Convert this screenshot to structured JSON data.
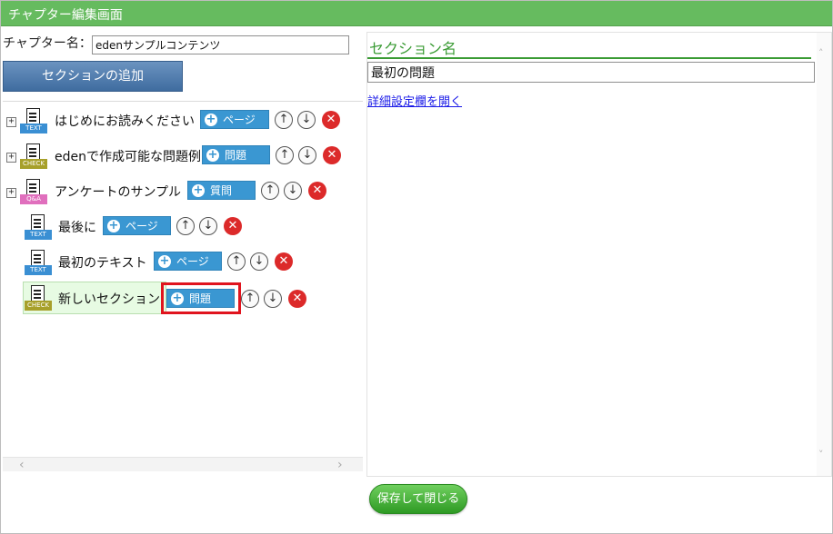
{
  "window": {
    "title": "チャプター編集画面"
  },
  "chapter": {
    "name_label": "チャプター名：",
    "name_value": "edenサンプルコンテンツ"
  },
  "add_section_label": "セクションの追加",
  "tree": [
    {
      "label": "はじめにお読みください",
      "icon": "text-doc-icon",
      "tag": "TEXT",
      "button": "ページ",
      "expandable": true
    },
    {
      "label": "edenで作成可能な問題例",
      "icon": "check-doc-icon",
      "tag": "CHECK",
      "button": "問題",
      "expandable": true
    },
    {
      "label": "アンケートのサンプル",
      "icon": "qa-doc-icon",
      "tag": "Q&A",
      "button": "質問",
      "expandable": true
    },
    {
      "label": "最後に",
      "icon": "text-doc-icon",
      "tag": "TEXT",
      "button": "ページ",
      "expandable": false
    },
    {
      "label": "最初のテキスト",
      "icon": "text-doc-icon",
      "tag": "TEXT",
      "button": "ページ",
      "expandable": false
    },
    {
      "label": "新しいセクション",
      "icon": "check-doc-icon",
      "tag": "CHECK",
      "button": "問題",
      "expandable": false,
      "selected": true,
      "highlighted": true
    }
  ],
  "detail": {
    "title": "セクション名",
    "section_name_value": "最初の問題",
    "open_details_link": "詳細設定欄を開く"
  },
  "save_button": "保存して閉じる",
  "colors": {
    "titlebar": "#66bb5f",
    "accent_green": "#3a9b34",
    "add_button": "#3a97d2",
    "delete": "#dc2a2a",
    "highlight": "#e0141e"
  },
  "glyphs": {
    "expand": "+",
    "plus": "+",
    "up": "↑",
    "down": "↓",
    "delete": "✕",
    "scroll_left": "‹",
    "scroll_right": "›",
    "scroll_up": "˄",
    "scroll_down": "˅"
  }
}
